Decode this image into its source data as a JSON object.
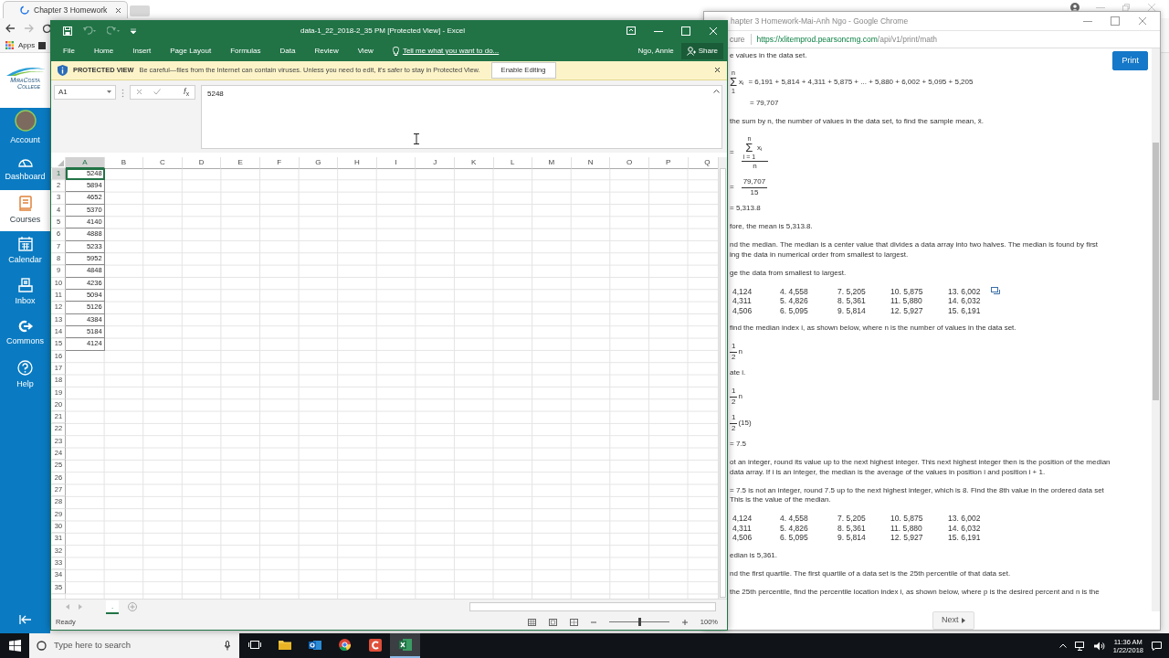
{
  "browser": {
    "tab_title": "Chapter 3 Homework",
    "bookmark": "Apps"
  },
  "canvas_nav": {
    "logo": {
      "line1": "MiraCosta",
      "line2": "College"
    },
    "items": [
      {
        "label": "Account",
        "selected": false
      },
      {
        "label": "Dashboard",
        "selected": false
      },
      {
        "label": "Courses",
        "selected": true
      },
      {
        "label": "Calendar",
        "selected": false
      },
      {
        "label": "Inbox",
        "selected": false
      },
      {
        "label": "Commons",
        "selected": false
      },
      {
        "label": "Help",
        "selected": false
      }
    ]
  },
  "pearson_window": {
    "title": "hapter 3 Homework-Mai-Anh Ngo - Google Chrome",
    "security": "cure",
    "url_host": "https://xlitemprod.pearsoncmg.com",
    "url_path": "/api/v1/print/math",
    "print": "Print",
    "next": "Next",
    "blocks": [
      {
        "kind": "text",
        "lines": [
          "e values in the data set."
        ]
      },
      {
        "kind": "sum",
        "upper": "n",
        "sigma": "Σ",
        "lower": "1",
        "term": "x$_{i}$",
        "rhs": "=  6,191 + 5,814 + 4,311 + 5,875 + ... + 5,880 + 6,002 + 5,095 + 5,205"
      },
      {
        "kind": "eq",
        "text": "= 79,707",
        "indent": true
      },
      {
        "kind": "text",
        "lines": [
          "the sum by n, the number of values in the data set, to find the sample mean, x̄."
        ]
      },
      {
        "kind": "sumfrac",
        "lead": "=",
        "num": {
          "upper": "n",
          "sigma": "Σ",
          "lower": "i = 1",
          "term": "x$_{i}$"
        },
        "den": "n"
      },
      {
        "kind": "frac",
        "lead": "=",
        "num": "79,707",
        "den": "15"
      },
      {
        "kind": "eq",
        "text": "= 5,313.8",
        "indent": false
      },
      {
        "kind": "text",
        "lines": [
          "fore, the mean is 5,313.8."
        ]
      },
      {
        "kind": "text",
        "lines": [
          "nd the median. The median is a center value that divides a data array into two halves. The median is found by first",
          "ing the data in numerical order from smallest to largest."
        ]
      },
      {
        "kind": "text",
        "lines": [
          "ge the data from smallest to largest."
        ]
      },
      {
        "kind": "table",
        "copy_button": true,
        "rows": [
          [
            "4,124",
            "4. 4,558",
            "7. 5,205",
            "10. 5,875",
            "13. 6,002"
          ],
          [
            "4,311",
            "5. 4,826",
            "8. 5,361",
            "11. 5,880",
            "14. 6,032"
          ],
          [
            "4,506",
            "6. 5,095",
            "9. 5,814",
            "12. 5,927",
            "15. 6,191"
          ]
        ]
      },
      {
        "kind": "text",
        "lines": [
          "find the median index i, as shown below, where n is the number of values in the data set."
        ]
      },
      {
        "kind": "frac",
        "num": "1",
        "den": "2",
        "tail": "n"
      },
      {
        "kind": "text",
        "lines": [
          "ate i."
        ]
      },
      {
        "kind": "frac",
        "num": "1",
        "den": "2",
        "tail": "n"
      },
      {
        "kind": "frac",
        "num": "1",
        "den": "2",
        "tail": "(15)"
      },
      {
        "kind": "eq",
        "text": "= 7.5",
        "indent": false
      },
      {
        "kind": "text",
        "lines": [
          "ot an integer, round its value up to the next highest integer. This next highest integer then is the position of the median",
          "data array. If i is an integer, the median is the average of the values in position i and position i + 1."
        ]
      },
      {
        "kind": "text",
        "lines": [
          "= 7.5 is not an integer, round 7.5 up to the next highest integer, which is 8. Find the 8th value in the ordered data set",
          "This is the value of the median."
        ]
      },
      {
        "kind": "table",
        "copy_button": false,
        "rows": [
          [
            "4,124",
            "4. 4,558",
            "7. 5,205",
            "10. 5,875",
            "13. 6,002"
          ],
          [
            "4,311",
            "5. 4,826",
            "8. 5,361",
            "11. 5,880",
            "14. 6,032"
          ],
          [
            "4,506",
            "6. 5,095",
            "9. 5,814",
            "12. 5,927",
            "15. 6,191"
          ]
        ]
      },
      {
        "kind": "text",
        "lines": [
          "edian is 5,361."
        ]
      },
      {
        "kind": "text",
        "lines": [
          "nd the first quartile. The first quartile of a data set is the 25th percentile of that data set."
        ]
      },
      {
        "kind": "text",
        "lines": [
          "the 25th percentile, find the percentile location index i, as shown below, where p is the desired percent and n is the"
        ]
      }
    ]
  },
  "excel": {
    "title": "data-1_22_2018-2_35 PM  [Protected View] - Excel",
    "tabs": [
      "File",
      "Home",
      "Insert",
      "Page Layout",
      "Formulas",
      "Data",
      "Review",
      "View"
    ],
    "tell_me": "Tell me what you want to do...",
    "user": "Ngo, Annie",
    "share": "Share",
    "protected": {
      "label": "PROTECTED VIEW",
      "message": "Be careful—files from the Internet can contain viruses. Unless you need to edit, it's safer to stay in Protected View.",
      "button": "Enable Editing"
    },
    "name_box": "A1",
    "fx": "*f*$_{x}$",
    "formula": "5248",
    "columns": [
      "A",
      "B",
      "C",
      "D",
      "E",
      "F",
      "G",
      "H",
      "I",
      "J",
      "K",
      "L",
      "M",
      "N",
      "O",
      "P",
      "Q"
    ],
    "rows": [
      {
        "number": "1",
        "value": "5248",
        "selected": true
      },
      {
        "number": "2",
        "value": "5894",
        "selected": false
      },
      {
        "number": "3",
        "value": "4652",
        "selected": false
      },
      {
        "number": "4",
        "value": "5370",
        "selected": false
      },
      {
        "number": "5",
        "value": "4140",
        "selected": false
      },
      {
        "number": "6",
        "value": "4888",
        "selected": false
      },
      {
        "number": "7",
        "value": "5233",
        "selected": false
      },
      {
        "number": "8",
        "value": "5952",
        "selected": false
      },
      {
        "number": "9",
        "value": "4848",
        "selected": false
      },
      {
        "number": "10",
        "value": "4236",
        "selected": false
      },
      {
        "number": "11",
        "value": "5094",
        "selected": false
      },
      {
        "number": "12",
        "value": "5126",
        "selected": false
      },
      {
        "number": "13",
        "value": "4384",
        "selected": false
      },
      {
        "number": "14",
        "value": "5184",
        "selected": false
      },
      {
        "number": "15",
        "value": "4124",
        "selected": false
      },
      {
        "number": "16"
      },
      {
        "number": "17"
      },
      {
        "number": "18"
      },
      {
        "number": "19"
      },
      {
        "number": "20"
      },
      {
        "number": "21"
      },
      {
        "number": "22"
      },
      {
        "number": "23"
      },
      {
        "number": "24"
      },
      {
        "number": "25"
      },
      {
        "number": "26"
      },
      {
        "number": "27"
      },
      {
        "number": "28"
      },
      {
        "number": "29"
      },
      {
        "number": "30"
      },
      {
        "number": "31"
      },
      {
        "number": "32"
      },
      {
        "number": "33"
      },
      {
        "number": "34"
      },
      {
        "number": "35"
      }
    ],
    "sheet_tabs": [
      {
        "label": ".",
        "selected": true
      }
    ],
    "status": "Ready",
    "zoom": {
      "label": "100%",
      "level": 0.5
    }
  },
  "taskbar": {
    "search_placeholder": "Type here to search",
    "apps": [
      {
        "selected": false
      },
      {
        "selected": false
      },
      {
        "selected": false
      },
      {
        "selected": false
      },
      {
        "selected": true
      }
    ],
    "time": "11:36 AM",
    "date": "1/22/2018"
  }
}
